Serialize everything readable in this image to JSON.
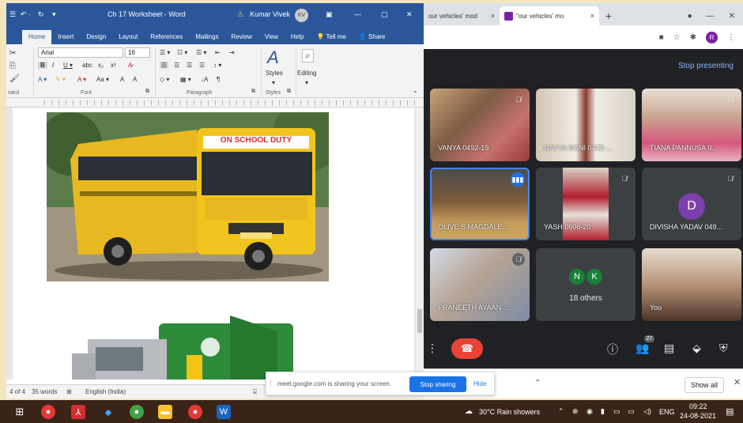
{
  "word": {
    "title": "Ch 17 Worksheet - Word",
    "warning_icon": "warning-icon",
    "user_name": "Kumar Vivek",
    "user_initials": "KV",
    "menu_tabs": [
      "Home",
      "Insert",
      "Design",
      "Layout",
      "References",
      "Mailings",
      "Review",
      "View",
      "Help",
      "Tell me",
      "Share"
    ],
    "ribbon": {
      "font_name": "Arial",
      "font_size": "16",
      "clipboard_label": "oard",
      "font_group": "Font",
      "paragraph_group": "Paragraph",
      "styles_group": "Styles",
      "styles_label": "Styles",
      "editing_label": "Editing"
    },
    "status": {
      "page": "4 of 4",
      "words": "35 words",
      "language": "English (India)"
    },
    "bus_sign": "ON SCHOOL DUTY"
  },
  "chrome": {
    "tabs": [
      {
        "title": "our vehicles' mod",
        "close": "×"
      },
      {
        "title": "\"our vehicles' mo",
        "close": "×"
      }
    ],
    "new_tab": "+"
  },
  "meet": {
    "stop_presenting": "Stop presenting",
    "participants": [
      {
        "name": "VANYA 0492-19",
        "muted": true
      },
      {
        "name": "NAVYA SONI 0433-...",
        "muted": false
      },
      {
        "name": "TIANA PANNUSA 0...",
        "muted": true
      },
      {
        "name": "OLIVE S MAGDALE...",
        "speaking": true
      },
      {
        "name": "YASH 0606-20",
        "muted": true
      },
      {
        "name": "DIVISHA YADAV 049...",
        "muted": true,
        "initial": "D"
      },
      {
        "name": "PRANEETH AYAAN ...",
        "muted": true
      },
      {
        "name": "18 others",
        "initials": [
          "N",
          "K"
        ]
      },
      {
        "name": "You",
        "muted": false
      }
    ],
    "people_count": "27"
  },
  "share_bar": {
    "text": "meet.google.com is sharing your screen.",
    "stop_label": "Stop sharing",
    "hide_label": "Hide"
  },
  "downloads": {
    "show_all": "Show all"
  },
  "taskbar": {
    "weather": "30°C  Rain showers",
    "language": "ENG",
    "time": "09:22",
    "date": "24-08-2021"
  },
  "colors": {
    "word_blue": "#2b579a",
    "meet_dark": "#202124",
    "end_call_red": "#ea4335",
    "meet_blue": "#1a73e8",
    "avatar_purple": "#7b3fae",
    "avatar_green": "#188038"
  }
}
